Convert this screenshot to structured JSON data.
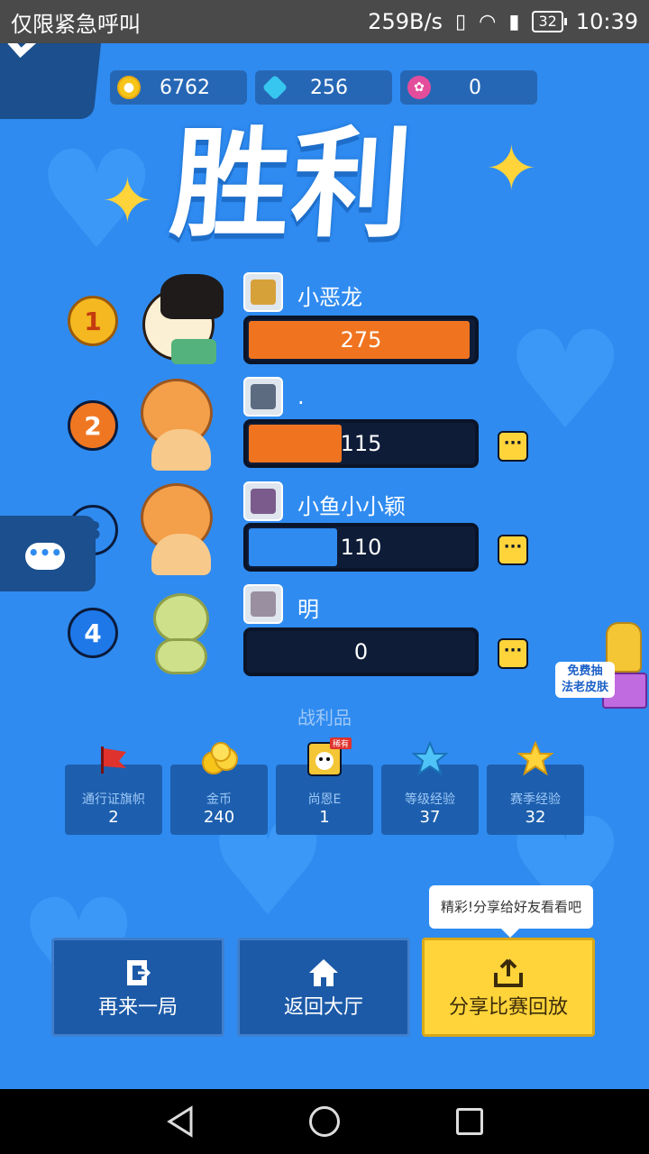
{
  "status_bar": {
    "carrier": "仅限紧急呼叫",
    "speed": "259B/s",
    "battery": "32",
    "time": "10:39"
  },
  "currencies": [
    {
      "icon": "coin-icon",
      "value": "6762"
    },
    {
      "icon": "diamond-icon",
      "value": "256"
    },
    {
      "icon": "flower-icon",
      "value": "0"
    }
  ],
  "title": "胜利",
  "players": [
    {
      "rank": "1",
      "name": "小恶龙",
      "score": "275",
      "fill": 1.0,
      "fill_color": "#f0741f"
    },
    {
      "rank": "2",
      "name": ".",
      "score": "115",
      "fill": 0.42,
      "fill_color": "#f0741f"
    },
    {
      "rank": "3",
      "name": "小鱼小小颖",
      "score": "110",
      "fill": 0.4,
      "fill_color": "#2f8bf0"
    },
    {
      "rank": "4",
      "name": "明",
      "score": "0",
      "fill": 0,
      "fill_color": "#2f8bf0"
    }
  ],
  "more_label": "···",
  "free_skin": {
    "line1": "免费抽",
    "line2": "法老皮肤"
  },
  "loot_title": "战利品",
  "loot": [
    {
      "name": "通行证旗帜",
      "count": "2",
      "icon": "flag-icon"
    },
    {
      "name": "金币",
      "count": "240",
      "icon": "coins-icon"
    },
    {
      "name": "尚恩E",
      "count": "1",
      "icon": "character-card-icon",
      "badge": "稀有"
    },
    {
      "name": "等级经验",
      "count": "37",
      "icon": "blue-star-icon"
    },
    {
      "name": "赛季经验",
      "count": "32",
      "icon": "gold-star-icon"
    }
  ],
  "tooltip": "精彩!分享给好友看看吧",
  "buttons": {
    "again": "再来一局",
    "lobby": "返回大厅",
    "share": "分享比赛回放"
  },
  "colors": {
    "background": "#2f8bf0",
    "accent_yellow": "#ffd43a",
    "orange": "#f0741f"
  }
}
